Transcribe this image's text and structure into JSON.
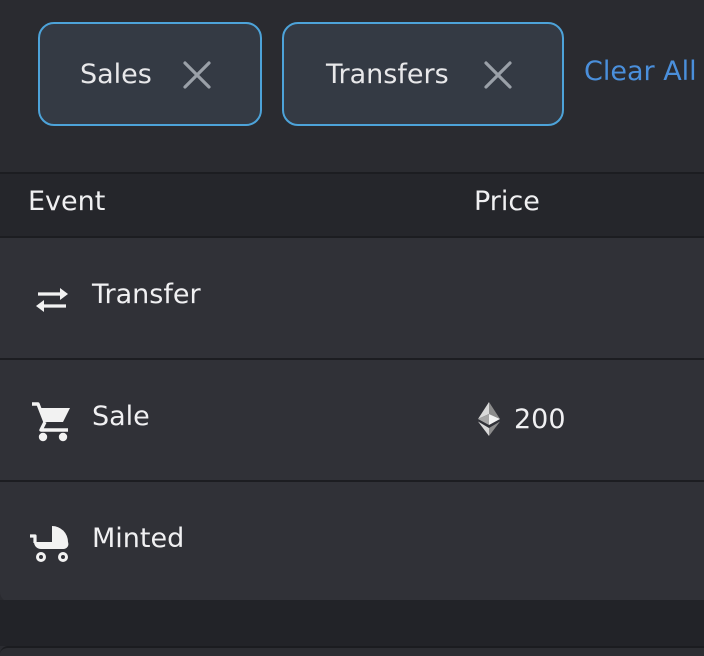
{
  "filters": {
    "chips": [
      {
        "label": "Sales",
        "close_icon": "close-icon"
      },
      {
        "label": "Transfers",
        "close_icon": "close-icon"
      }
    ],
    "clear_all_label": "Clear All",
    "chip_border_color": "#4da3d9",
    "link_color": "#4a8fdb"
  },
  "table": {
    "columns": {
      "event": "Event",
      "price": "Price"
    },
    "rows": [
      {
        "event": "Transfer",
        "icon": "transfer-arrows-icon",
        "price": ""
      },
      {
        "event": "Sale",
        "icon": "shopping-cart-icon",
        "price": "200",
        "currency_icon": "ethereum-icon"
      },
      {
        "event": "Minted",
        "icon": "baby-stroller-icon",
        "price": ""
      }
    ]
  }
}
